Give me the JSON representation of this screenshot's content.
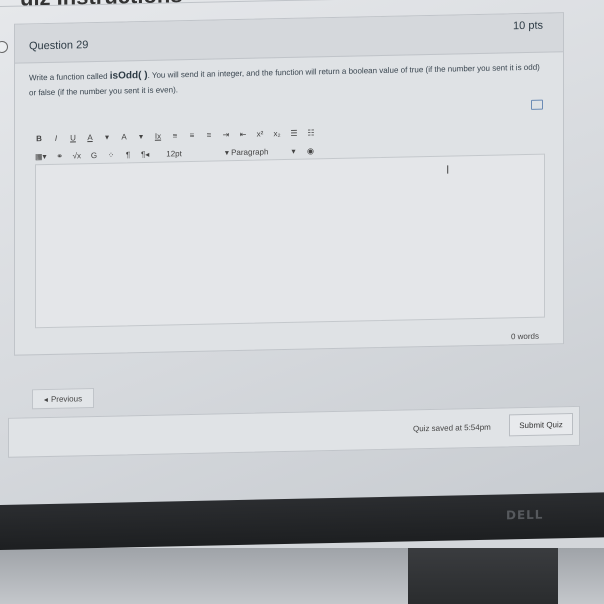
{
  "page": {
    "partial_title": "uiz Instructions"
  },
  "question": {
    "title": "Question 29",
    "points": "10 pts",
    "text_before": "Write a function called ",
    "function_name": "isOdd( )",
    "text_after": ". You will send it an integer, and the function will return a boolean value of true (if the number you sent it is odd) or false (if the number you sent it is even)."
  },
  "toolbar": {
    "row1": [
      "B",
      "I",
      "U",
      "A",
      "▾",
      "A",
      "▾",
      "Ix",
      "≡",
      "≡",
      "≡",
      "⇥",
      "⇤",
      "x²",
      "x₂",
      "☰",
      "☷"
    ],
    "row2": [
      "▦▾",
      "⚭",
      "√x",
      "G",
      "⁘",
      "¶",
      "¶◂",
      "12pt",
      "▾ Paragraph",
      "▾",
      "◉"
    ]
  },
  "editor": {
    "word_count": "0 words"
  },
  "navigation": {
    "previous_label": "Previous"
  },
  "submit": {
    "saved_text": "Quiz saved at 5:54pm",
    "submit_label": "Submit Quiz"
  },
  "monitor": {
    "brand": "DELL"
  }
}
